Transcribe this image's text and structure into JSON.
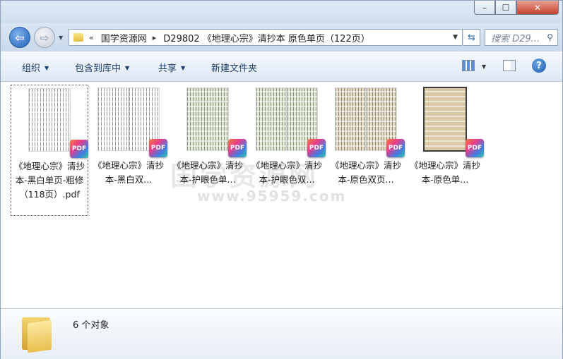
{
  "window": {
    "minimize_label": "–",
    "maximize_label": "☐",
    "close_label": "✕"
  },
  "nav": {
    "back_glyph": "⇦",
    "forward_glyph": "⇨",
    "breadcrumb_prefix": "«",
    "breadcrumb": [
      "国学资源网",
      "D29802 《地理心宗》清抄本 原色单页（122页）"
    ],
    "breadcrumb_sep": "▸",
    "search_placeholder": "搜索 D29..."
  },
  "toolbar": {
    "organize": "组织",
    "include_in_library": "包含到库中",
    "share": "共享",
    "new_folder": "新建文件夹",
    "help": "?"
  },
  "files": [
    {
      "label": "《地理心宗》清抄本-黑白单页-粗修（118页）.pdf",
      "tone": "#ffffff",
      "layout": "single",
      "selected": true
    },
    {
      "label": "《地理心宗》清抄本-黑白双...",
      "tone": "#ffffff",
      "layout": "double",
      "selected": false
    },
    {
      "label": "《地理心宗》清抄本-护眼色单...",
      "tone": "#dfe9d2",
      "layout": "single",
      "selected": false
    },
    {
      "label": "《地理心宗》清抄本-护眼色双...",
      "tone": "#dfe9d2",
      "layout": "double",
      "selected": false
    },
    {
      "label": "《地理心宗》清抄本-原色双页...",
      "tone": "#e6dcc6",
      "layout": "double",
      "selected": false
    },
    {
      "label": "《地理心宗》清抄本-原色单...",
      "tone": "#d9c9a6",
      "layout": "single",
      "selected": false
    }
  ],
  "pdf_badge": "PDF",
  "watermark": {
    "line1": "国学资源网",
    "line2": "www.95959.com"
  },
  "status": {
    "count_text": "6 个对象"
  },
  "colors": {
    "accent": "#1f5fb8",
    "close": "#c6422d"
  }
}
